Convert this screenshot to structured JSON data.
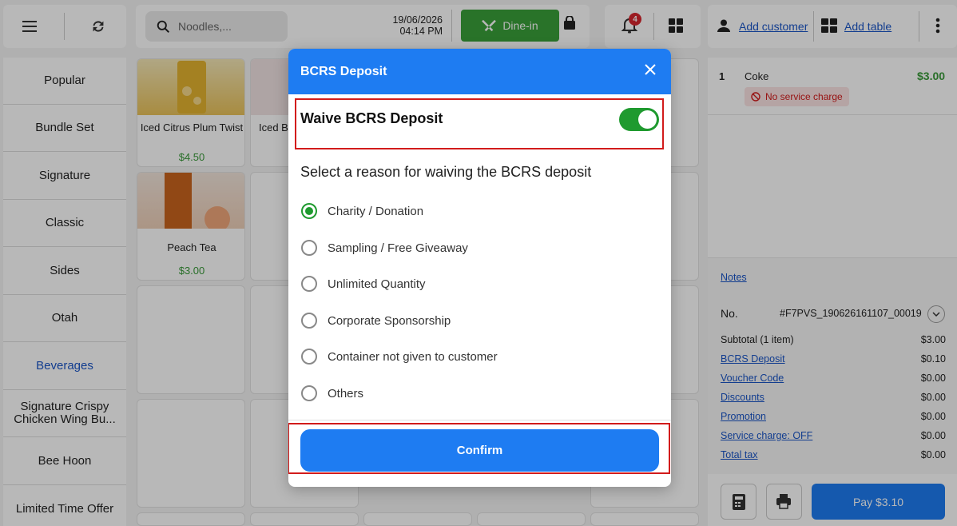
{
  "header": {
    "search_placeholder": "Noodles,...",
    "date": "19/06/2026",
    "time": "04:14 PM",
    "dine_in_label": "Dine-in",
    "notification_count": "4",
    "add_customer": "Add customer",
    "add_table": "Add table"
  },
  "categories": [
    {
      "label": "Popular"
    },
    {
      "label": "Bundle Set"
    },
    {
      "label": "Signature"
    },
    {
      "label": "Classic"
    },
    {
      "label": "Sides"
    },
    {
      "label": "Otah"
    },
    {
      "label": "Beverages"
    },
    {
      "label": "Signature Crispy Chicken Wing Bu..."
    },
    {
      "label": "Bee Hoon"
    },
    {
      "label": "Limited Time Offer"
    }
  ],
  "products": [
    {
      "name": "Iced Citrus Plum Twist",
      "price": "$4.50"
    },
    {
      "name": "Iced B",
      "price": ""
    },
    {
      "name": "Peach Tea",
      "price": "$3.00"
    }
  ],
  "order": {
    "items": [
      {
        "qty": "1",
        "name": "Coke",
        "price": "$3.00",
        "badge": "No service charge"
      }
    ],
    "notes_label": "Notes",
    "no_label": "No.",
    "order_no": "#F7PVS_190626161107_00019",
    "summary": [
      {
        "label": "Subtotal (1 item)",
        "value": "$3.00"
      },
      {
        "label": "BCRS Deposit",
        "value": "$0.10"
      },
      {
        "label": "Voucher Code",
        "value": "$0.00"
      },
      {
        "label": "Discounts",
        "value": "$0.00"
      },
      {
        "label": "Promotion",
        "value": "$0.00"
      },
      {
        "label": "Service charge: OFF",
        "value": "$0.00"
      },
      {
        "label": "Total tax",
        "value": "$0.00"
      }
    ],
    "pay_label": "Pay $3.10"
  },
  "modal": {
    "title": "BCRS Deposit",
    "waive_label": "Waive BCRS Deposit",
    "waive_on": true,
    "reason_title": "Select a reason for waiving the BCRS deposit",
    "reasons": [
      {
        "label": "Charity / Donation",
        "selected": true
      },
      {
        "label": "Sampling / Free Giveaway",
        "selected": false
      },
      {
        "label": "Unlimited Quantity",
        "selected": false
      },
      {
        "label": "Corporate Sponsorship",
        "selected": false
      },
      {
        "label": "Container not given to customer",
        "selected": false
      },
      {
        "label": "Others",
        "selected": false
      }
    ],
    "confirm_label": "Confirm"
  },
  "colors": {
    "primary": "#1e7cf2",
    "green": "#3aa03a",
    "highlight": "#d21b1b",
    "link": "#1a55c7"
  }
}
